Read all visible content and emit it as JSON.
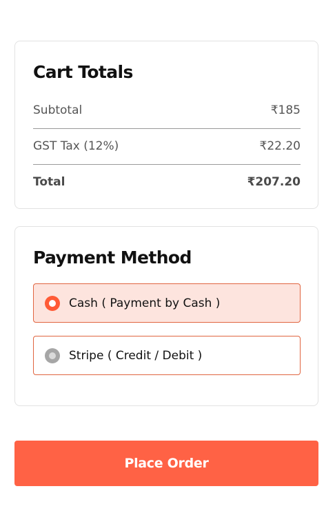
{
  "cart_totals": {
    "title": "Cart Totals",
    "subtotal_label": "Subtotal",
    "subtotal_value": "₹185",
    "tax_label": "GST Tax (12%)",
    "tax_value": "₹22.20",
    "total_label": "Total",
    "total_value": "₹207.20"
  },
  "payment": {
    "title": "Payment Method",
    "options": [
      {
        "label": "Cash ( Payment by Cash )",
        "selected": true
      },
      {
        "label": "Stripe ( Credit / Debit )",
        "selected": false
      }
    ]
  },
  "actions": {
    "place_order_label": "Place Order"
  },
  "colors": {
    "accent": "#ff6245",
    "selected_option_bg": "#fde4de",
    "option_border": "#e0643f"
  }
}
